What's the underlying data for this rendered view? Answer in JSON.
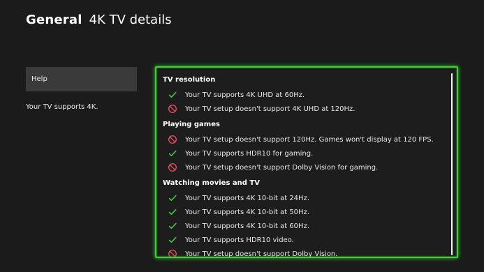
{
  "header": {
    "section": "General",
    "page": "4K TV details"
  },
  "sidebar": {
    "help_label": "Help",
    "summary": "Your TV supports 4K."
  },
  "colors": {
    "accent_green": "#37d32f",
    "check_green": "#4ccf45",
    "error_red": "#e04d5c"
  },
  "details": {
    "groups": [
      {
        "title": "TV resolution",
        "items": [
          {
            "icon": "check-icon",
            "text": "Your TV supports 4K UHD at 60Hz."
          },
          {
            "icon": "not-supported-icon",
            "text": "Your TV setup doesn't support 4K UHD at 120Hz."
          }
        ]
      },
      {
        "title": "Playing games",
        "items": [
          {
            "icon": "not-supported-icon",
            "text": "Your TV setup doesn't support 120Hz. Games won't display at 120 FPS."
          },
          {
            "icon": "check-icon",
            "text": "Your TV supports HDR10 for gaming."
          },
          {
            "icon": "not-supported-icon",
            "text": "Your TV setup doesn't support Dolby Vision for gaming."
          }
        ]
      },
      {
        "title": "Watching movies and TV",
        "items": [
          {
            "icon": "check-icon",
            "text": "Your TV supports 4K 10-bit at 24Hz."
          },
          {
            "icon": "check-icon",
            "text": "Your TV supports 4K 10-bit at 50Hz."
          },
          {
            "icon": "check-icon",
            "text": "Your TV supports 4K 10-bit at 60Hz."
          },
          {
            "icon": "check-icon",
            "text": "Your TV supports HDR10 video."
          },
          {
            "icon": "not-supported-icon",
            "text": "Your TV setup doesn't support Dolby Vision."
          }
        ]
      }
    ]
  }
}
